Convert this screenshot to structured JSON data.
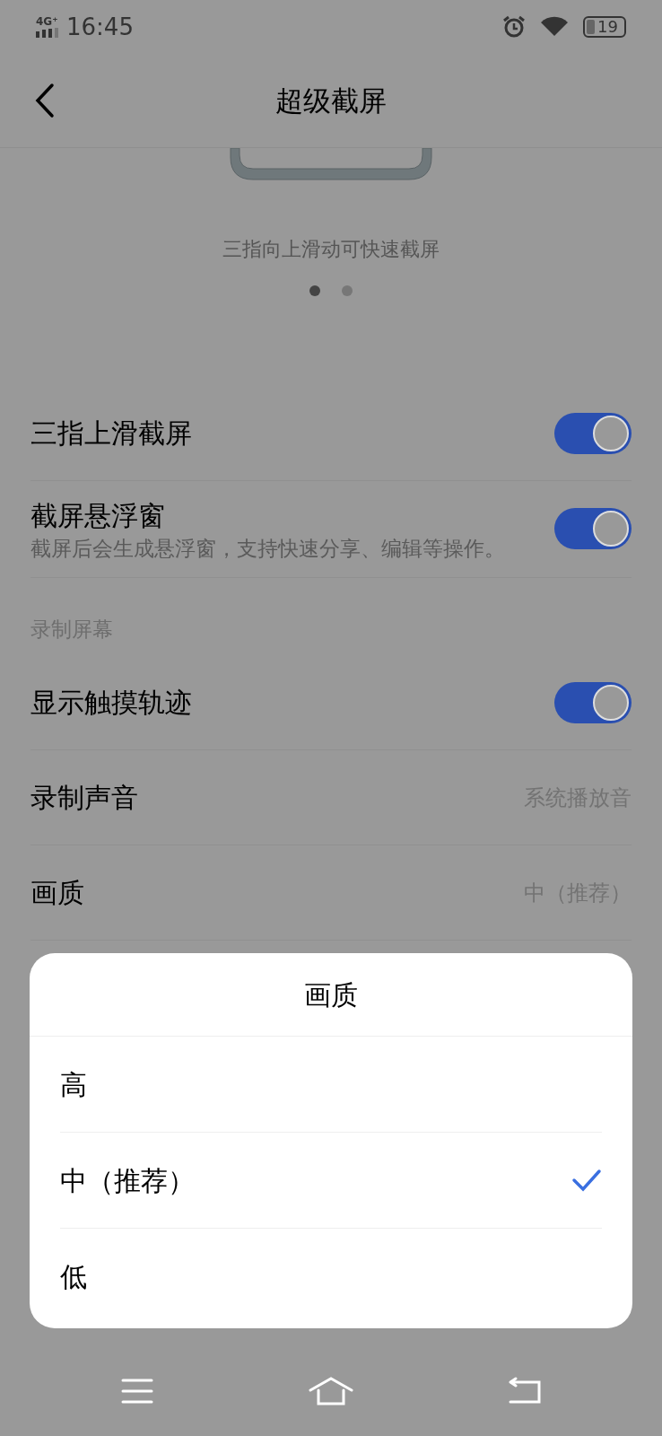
{
  "status_bar": {
    "network": "4G⁺",
    "time": "16:45",
    "battery": "19"
  },
  "header": {
    "title": "超级截屏"
  },
  "carousel": {
    "caption": "三指向上滑动可快速截屏",
    "dots": [
      {
        "selected": true
      },
      {
        "selected": false
      }
    ]
  },
  "settings": [
    {
      "kind": "toggle",
      "label": "三指上滑截屏",
      "on": true
    },
    {
      "kind": "toggle",
      "label": "截屏悬浮窗",
      "description": "截屏后会生成悬浮窗，支持快速分享、编辑等操作。",
      "on": true
    },
    {
      "kind": "section",
      "label": "录制屏幕"
    },
    {
      "kind": "toggle",
      "label": "显示触摸轨迹",
      "on": true
    },
    {
      "kind": "value",
      "label": "录制声音",
      "value": "系统播放音"
    },
    {
      "kind": "value",
      "label": "画质",
      "value": "中（推荐）"
    }
  ],
  "sheet": {
    "title": "画质",
    "options": [
      {
        "label": "高",
        "selected": false
      },
      {
        "label": "中（推荐）",
        "selected": true
      },
      {
        "label": "低",
        "selected": false
      }
    ]
  }
}
